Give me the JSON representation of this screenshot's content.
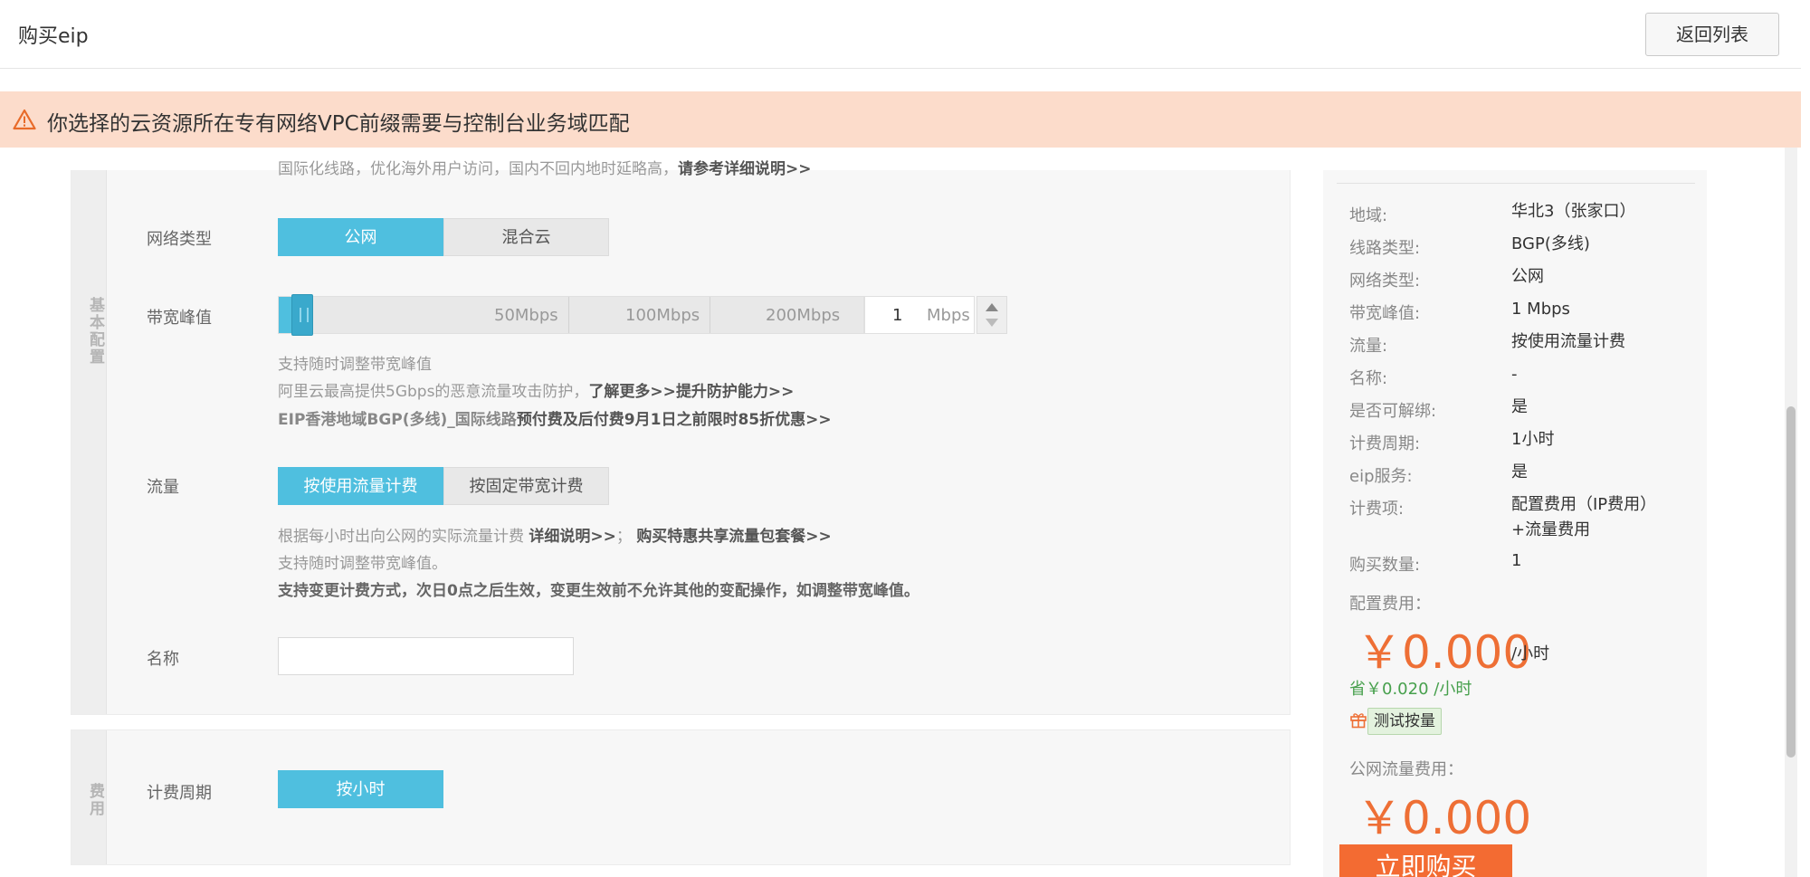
{
  "header": {
    "title": "购买eip",
    "back_label": "返回列表"
  },
  "warning": {
    "text": "你选择的云资源所在专有网络VPC前缀需要与控制台业务域匹配"
  },
  "basic": {
    "side_label": "基本配置",
    "cut_text": "国际化线路，优化海外用户访问，国内不回内地时延略高，",
    "cut_link": "请参考详细说明>>",
    "network": {
      "label": "网络类型",
      "options": [
        "公网",
        "混合云"
      ],
      "selected": "公网"
    },
    "bandwidth": {
      "label": "带宽峰值",
      "ticks": [
        "50Mbps",
        "100Mbps",
        "200Mbps"
      ],
      "value": "1",
      "unit": "Mbps",
      "level_fraction": 0.005,
      "help1": "支持随时调整带宽峰值",
      "help2_prefix": "阿里云最高提供5Gbps的恶意流量攻击防护，",
      "help2_link1": "了解更多>>",
      "help2_link2": "提升防护能力>>",
      "help3_a": "EIP香港地域BGP(多线)_国际线路",
      "help3_b": "预付费及后付费9月1日之前限时85折优惠>>"
    },
    "traffic": {
      "label": "流量",
      "options": [
        "按使用流量计费",
        "按固定带宽计费"
      ],
      "selected": "按使用流量计费",
      "help1_prefix": "根据每小时出向公网的实际流量计费",
      "help1_link1": "详细说明>>",
      "help1_sep": "；",
      "help1_link2": "购买特惠共享流量包套餐>>",
      "help2": "支持随时调整带宽峰值。",
      "help3": "支持变更计费方式，次日0点之后生效，变更生效前不允许其他的变配操作，如调整带宽峰值。"
    },
    "name": {
      "label": "名称",
      "value": ""
    }
  },
  "fee": {
    "side_label": "费用",
    "period": {
      "label": "计费周期",
      "options": [
        "按小时"
      ],
      "selected": "按小时"
    }
  },
  "summary": {
    "rows": [
      {
        "key": "地域:",
        "value": "华北3（张家口）"
      },
      {
        "key": "线路类型:",
        "value": "BGP(多线)"
      },
      {
        "key": "网络类型:",
        "value": "公网"
      },
      {
        "key": "带宽峰值:",
        "value": "1 Mbps"
      },
      {
        "key": "流量:",
        "value": "按使用流量计费"
      },
      {
        "key": "名称:",
        "value": "-"
      },
      {
        "key": "是否可解绑:",
        "value": "是"
      },
      {
        "key": "计费周期:",
        "value": "1小时"
      },
      {
        "key": "eip服务:",
        "value": "是"
      },
      {
        "key": "计费项:",
        "value": "配置费用（IP费用）",
        "value2": "+流量费用"
      },
      {
        "key": "购买数量:",
        "value": "1"
      }
    ],
    "config_fee_label": "配置费用：",
    "config_price": "￥0.000",
    "per_hour": "/小时",
    "save_text": "省￥0.020 /小时",
    "test_badge": "测试按量",
    "traffic_fee_label": "公网流量费用：",
    "traffic_price": "￥0.000",
    "buy_label": "立即购买"
  },
  "colors": {
    "primary": "#4fbfdf",
    "price": "#ee6f35",
    "buy": "#f36b32",
    "warning_bg": "#fcdccb",
    "save": "#47a04d"
  }
}
